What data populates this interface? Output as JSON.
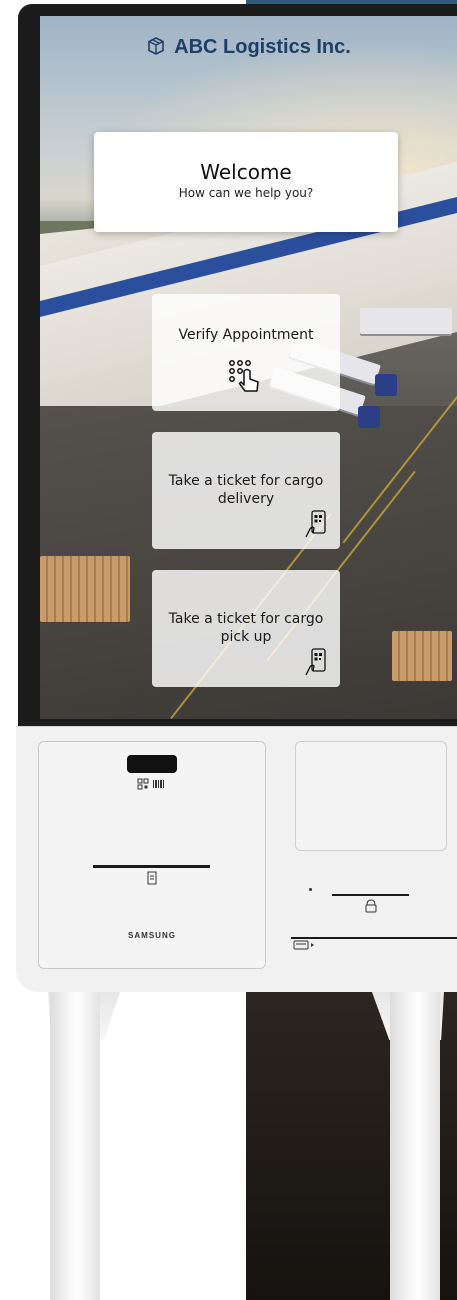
{
  "header": {
    "company_name": "ABC Logistics Inc.",
    "logo_icon": "package-icon"
  },
  "welcome": {
    "title": "Welcome",
    "subtitle": "How can we help you?"
  },
  "actions": [
    {
      "label": "Verify Appointment",
      "icon": "keypad-touch-icon"
    },
    {
      "label": "Take a ticket for cargo delivery",
      "icon": "phone-qr-icon"
    },
    {
      "label": "Take a ticket for cargo pick up",
      "icon": "phone-qr-icon"
    }
  ],
  "hardware": {
    "brand_label": "SAMSUNG"
  },
  "colors": {
    "brand_text": "#1f3f66",
    "card_bg": "#ffffff"
  }
}
